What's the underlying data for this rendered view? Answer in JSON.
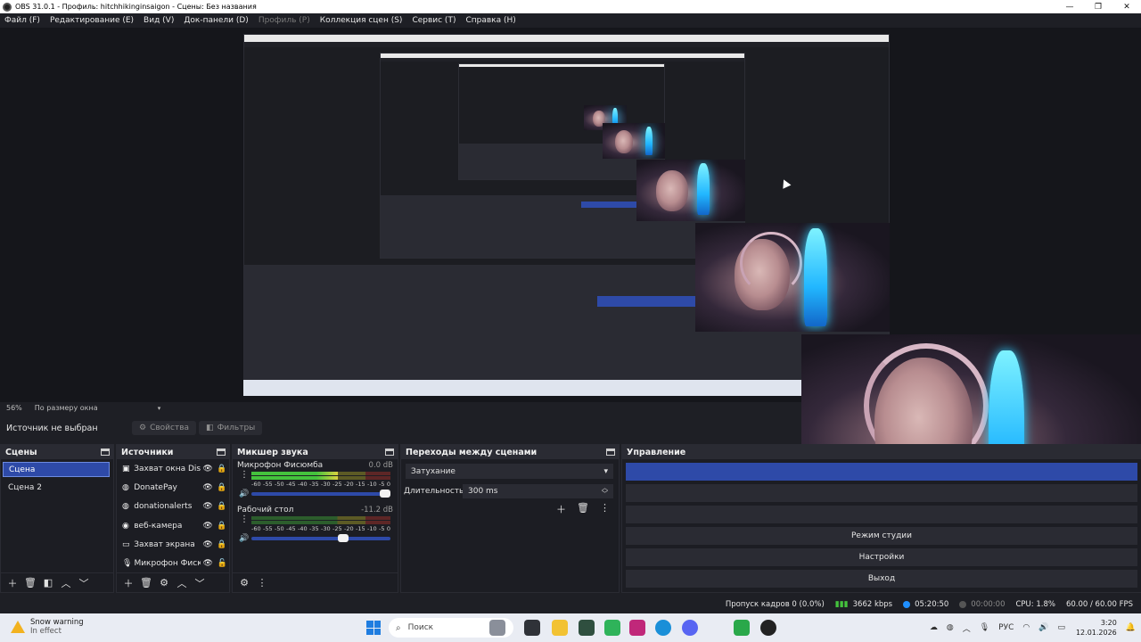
{
  "window": {
    "title": "OBS 31.0.1 - Профиль: hitchhikinginsaigon - Сцены: Без названия",
    "minimize_glyph": "—",
    "restore_glyph": "❐",
    "close_glyph": "✕"
  },
  "menu": [
    {
      "label": "Файл (F)",
      "disabled": false
    },
    {
      "label": "Редактирование (E)",
      "disabled": false
    },
    {
      "label": "Вид (V)",
      "disabled": false
    },
    {
      "label": "Док-панели (D)",
      "disabled": false
    },
    {
      "label": "Профиль (P)",
      "disabled": true
    },
    {
      "label": "Коллекция сцен (S)",
      "disabled": false
    },
    {
      "label": "Сервис (T)",
      "disabled": false
    },
    {
      "label": "Справка (H)",
      "disabled": false
    }
  ],
  "zoom": {
    "percent": "56%",
    "mode": "По размеру окна"
  },
  "source_toolbar": {
    "no_source": "Источник не выбран",
    "properties": "Свойства",
    "filters": "Фильтры"
  },
  "scenes": {
    "title": "Сцены",
    "items": [
      "Сцена",
      "Сцена 2"
    ],
    "active_index": 0
  },
  "sources": {
    "title": "Источники",
    "items": [
      {
        "name": "Захват окна Disc",
        "icon": "window-icon",
        "locked": true
      },
      {
        "name": "DonatePay",
        "icon": "browser-icon",
        "locked": true
      },
      {
        "name": "donationalerts",
        "icon": "browser-icon",
        "locked": true
      },
      {
        "name": "веб-камера",
        "icon": "camera-icon",
        "locked": true
      },
      {
        "name": "Захват экрана",
        "icon": "monitor-icon",
        "locked": true
      },
      {
        "name": "Микрофон Фиск",
        "icon": "mic-icon",
        "locked": false
      }
    ]
  },
  "mixer": {
    "title": "Микшер звука",
    "scale": [
      "-60",
      "-55",
      "-50",
      "-45",
      "-40",
      "-35",
      "-30",
      "-25",
      "-20",
      "-15",
      "-10",
      "-5",
      "0"
    ],
    "channels": [
      {
        "name": "Микрофон Фисюмба",
        "db": "0.0 dB",
        "level": 0.62,
        "volume": 1.0
      },
      {
        "name": "Рабочий стол",
        "db": "-11.2 dB",
        "level": 0.0,
        "volume": 0.7
      }
    ]
  },
  "transitions": {
    "title": "Переходы между сценами",
    "selected": "Затухание",
    "duration_label": "Длительность",
    "duration_value": "300 ms"
  },
  "controls": {
    "title": "Управление",
    "buttons": [
      "Режим студии",
      "Настройки",
      "Выход"
    ]
  },
  "status": {
    "dropped": "Пропуск кадров 0 (0.0%)",
    "bitrate": "3662 kbps",
    "stream_time": "05:20:50",
    "rec_time": "00:00:00",
    "cpu": "CPU: 1.8%",
    "fps": "60.00 / 60.00 FPS",
    "accent_live": "#1f8fff",
    "accent_signal": "#44c23d"
  },
  "taskbar": {
    "weather_title": "Snow warning",
    "weather_sub": "In effect",
    "search_placeholder": "Поиск",
    "lang": "РУС",
    "time": "3:20",
    "date": "12.01.2026"
  }
}
